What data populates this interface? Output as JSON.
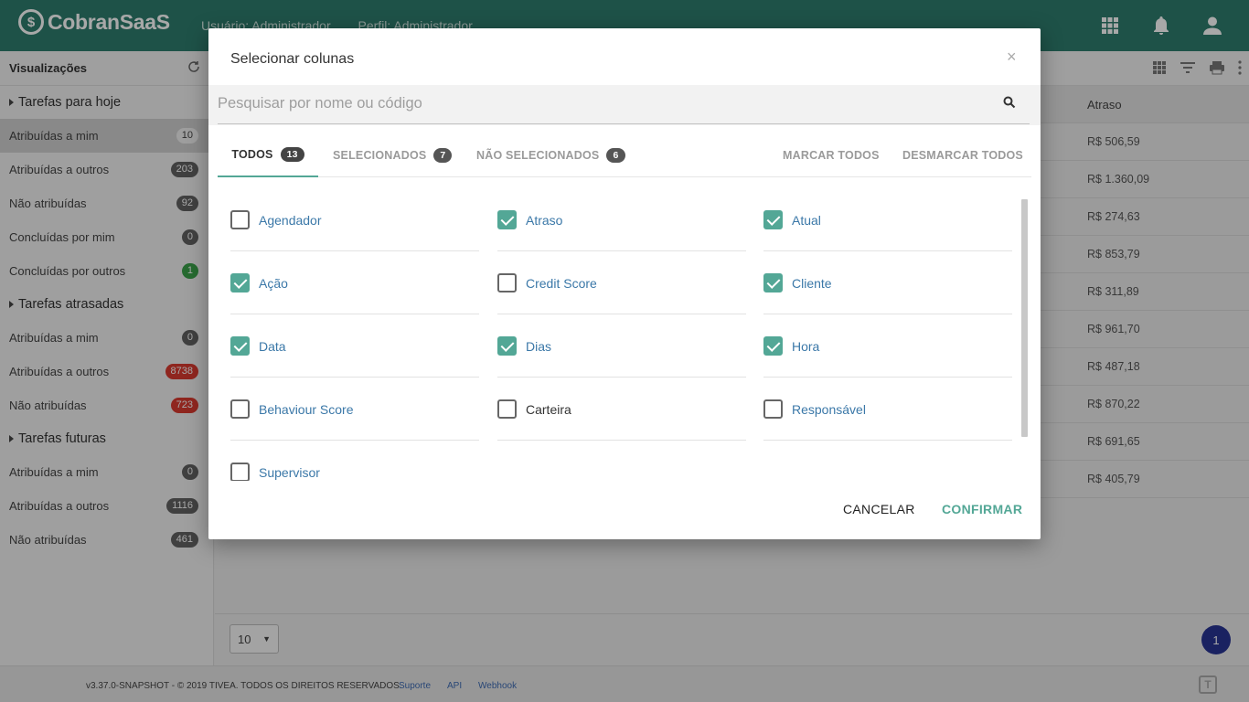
{
  "header": {
    "logo": "CobranSaaS",
    "logo_mark": "$",
    "user_label": "Usuário: Administrador",
    "profile_label": "Perfil: Administrador",
    "icons": [
      "apps-grid-icon",
      "bell-icon",
      "user-icon"
    ]
  },
  "sidebar": {
    "title": "Visualizações",
    "sections": [
      {
        "label": "Tarefas para hoje",
        "items": [
          {
            "label": "Atribuídas a mim",
            "count": "10"
          },
          {
            "label": "Atribuídas a outros",
            "count": "203"
          },
          {
            "label": "Não atribuídas",
            "count": "92"
          },
          {
            "label": "Concluídas por mim",
            "count": "0"
          },
          {
            "label": "Concluídas por outros",
            "count": "1"
          }
        ]
      },
      {
        "label": "Tarefas atrasadas",
        "items": [
          {
            "label": "Atribuídas a mim",
            "count": "0"
          },
          {
            "label": "Atribuídas a outros",
            "count": "8738"
          },
          {
            "label": "Não atribuídas",
            "count": "723"
          }
        ]
      },
      {
        "label": "Tarefas futuras",
        "items": [
          {
            "label": "Atribuídas a mim",
            "count": "0"
          },
          {
            "label": "Atribuídas a outros",
            "count": "1116"
          },
          {
            "label": "Não atribuídas",
            "count": "461"
          }
        ]
      }
    ]
  },
  "table": {
    "column_header": "Atraso",
    "values": [
      "R$ 506,59",
      "R$ 1.360,09",
      "R$ 274,63",
      "R$ 853,79",
      "R$ 311,89",
      "R$ 961,70",
      "R$ 487,18",
      "R$ 870,22",
      "R$ 691,65",
      "R$ 405,79"
    ],
    "page_size": "10",
    "current_page": "1"
  },
  "footer": {
    "copyright": "v3.37.0-SNAPSHOT - © 2019 TIVEA. TODOS OS DIREITOS RESERVADOS.",
    "links": [
      "Suporte",
      "API",
      "Webhook"
    ],
    "corner_glyph": "T"
  },
  "modal": {
    "title": "Selecionar colunas",
    "close_glyph": "×",
    "search_placeholder": "Pesquisar por nome ou código",
    "tabs": [
      {
        "label": "TODOS",
        "count": "13",
        "active": true
      },
      {
        "label": "SELECIONADOS",
        "count": "7",
        "active": false
      },
      {
        "label": "NÃO SELECIONADOS",
        "count": "6",
        "active": false
      }
    ],
    "mark_all": "MARCAR TODOS",
    "unmark_all": "DESMARCAR TODOS",
    "columns": [
      {
        "label": "Agendador",
        "checked": false
      },
      {
        "label": "Atraso",
        "checked": true
      },
      {
        "label": "Atual",
        "checked": true
      },
      {
        "label": "Ação",
        "checked": true
      },
      {
        "label": "Credit Score",
        "checked": false
      },
      {
        "label": "Cliente",
        "checked": true
      },
      {
        "label": "Data",
        "checked": true
      },
      {
        "label": "Dias",
        "checked": true
      },
      {
        "label": "Hora",
        "checked": true
      },
      {
        "label": "Behaviour Score",
        "checked": false
      },
      {
        "label": "Carteira",
        "checked": false
      },
      {
        "label": "Responsável",
        "checked": false
      },
      {
        "label": "Supervisor",
        "checked": false
      }
    ],
    "cancel_label": "CANCELAR",
    "confirm_label": "CONFIRMAR"
  },
  "colors": {
    "topbar": "#2e7d6e",
    "accent": "#53a796",
    "link": "#3b78a8",
    "badge_red": "#d93a2f",
    "badge_green": "#3aa14a",
    "page_button": "#283593"
  }
}
